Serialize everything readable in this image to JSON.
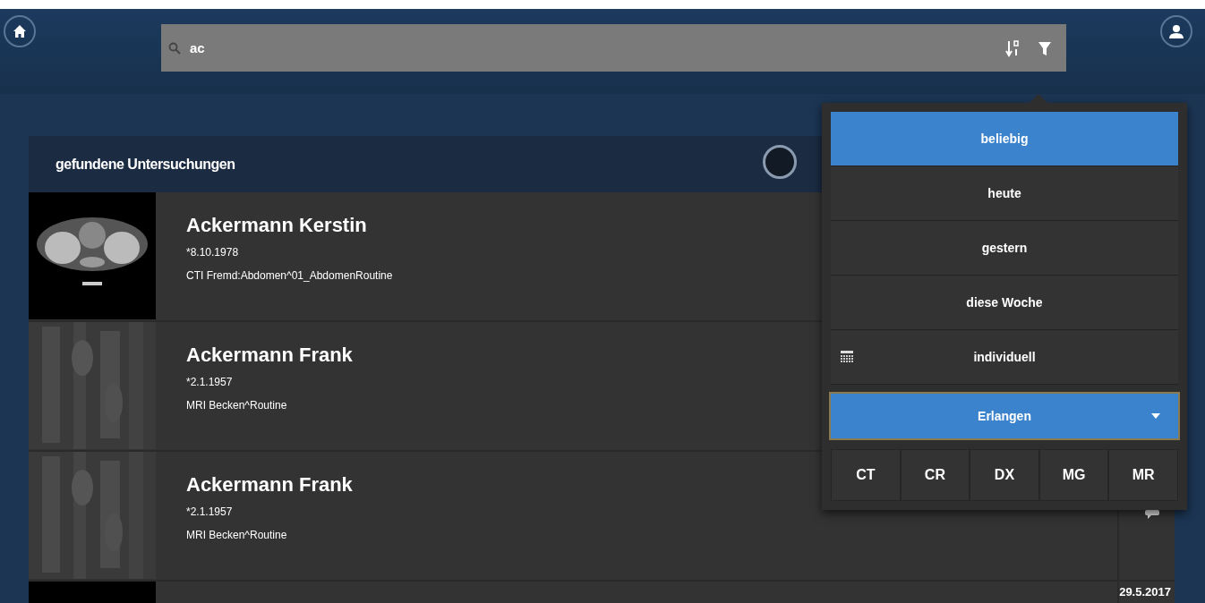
{
  "search": {
    "value": "ac"
  },
  "results": {
    "title": "gefundene Untersuchungen",
    "rows": [
      {
        "name": "Ackermann Kerstin",
        "birth": "*8.10.1978",
        "study": "CTI Fremd:Abdomen^01_AbdomenRoutine",
        "comment": false
      },
      {
        "name": "Ackermann Frank",
        "birth": "*2.1.1957",
        "study": "MRI Becken^Routine",
        "comment": false
      },
      {
        "name": "Ackermann Frank",
        "birth": "*2.1.1957",
        "study": "MRI Becken^Routine",
        "comment": true
      },
      {
        "date": "29.5.2017",
        "comment": false
      }
    ]
  },
  "filter": {
    "time_options": [
      {
        "label": "beliebig",
        "selected": true,
        "kind": "plain"
      },
      {
        "label": "heute",
        "selected": false,
        "kind": "plain"
      },
      {
        "label": "gestern",
        "selected": false,
        "kind": "plain"
      },
      {
        "label": "diese Woche",
        "selected": false,
        "kind": "plain"
      },
      {
        "label": "individuell",
        "selected": false,
        "kind": "calendar"
      }
    ],
    "location": "Erlangen",
    "modalities": [
      {
        "label": "CT",
        "selected": false
      },
      {
        "label": "CR",
        "selected": false
      },
      {
        "label": "DX",
        "selected": false
      },
      {
        "label": "MG",
        "selected": false
      },
      {
        "label": "MR",
        "selected": false
      }
    ]
  }
}
